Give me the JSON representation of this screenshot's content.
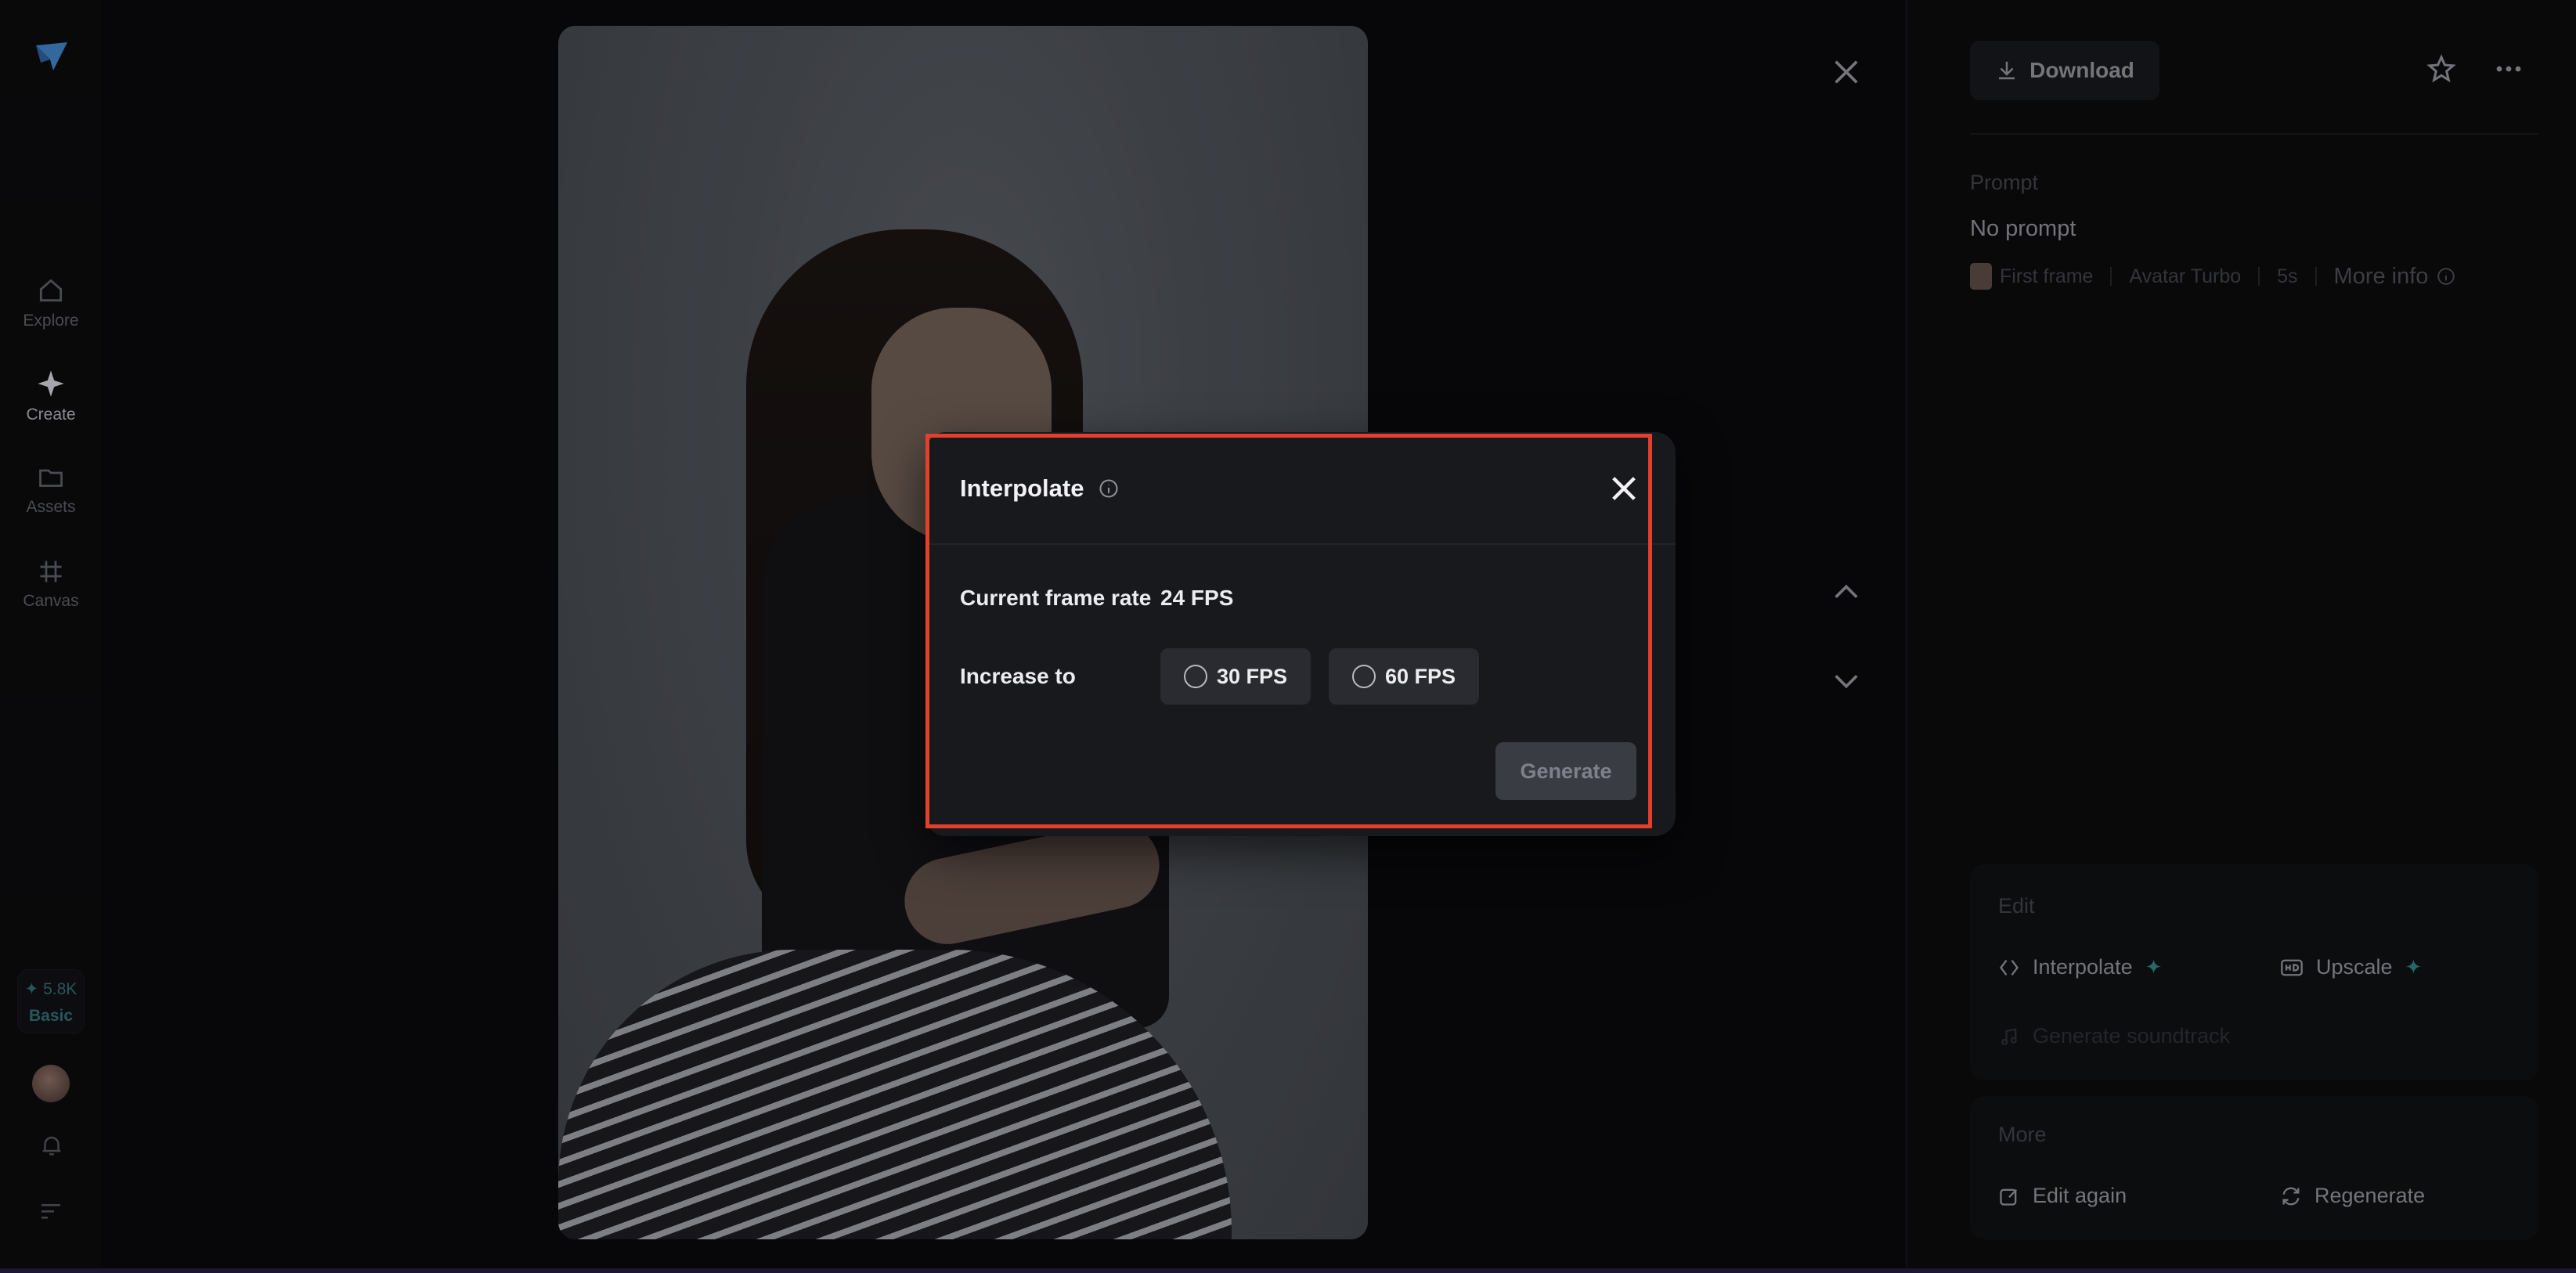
{
  "nav": {
    "items": [
      {
        "label": "Explore",
        "icon": "home-icon"
      },
      {
        "label": "Create",
        "icon": "sparkle-icon"
      },
      {
        "label": "Assets",
        "icon": "folder-icon"
      },
      {
        "label": "Canvas",
        "icon": "grid-icon"
      }
    ],
    "credits": {
      "amount": "✦ 5.8K",
      "plan": "Basic"
    }
  },
  "panel": {
    "download_label": "Download",
    "prompt_heading": "Prompt",
    "prompt_value": "No prompt",
    "meta": {
      "first_frame": "First frame",
      "model": "Avatar Turbo",
      "duration": "5s",
      "more_info": "More info"
    },
    "edit": {
      "heading": "Edit",
      "interpolate": "Interpolate",
      "upscale": "Upscale",
      "soundtrack": "Generate soundtrack"
    },
    "more": {
      "heading": "More",
      "edit_again": "Edit again",
      "regenerate": "Regenerate"
    }
  },
  "dialog": {
    "title": "Interpolate",
    "current_label": "Current frame rate",
    "current_value": "24 FPS",
    "increase_label": "Increase to",
    "options": [
      "30 FPS",
      "60 FPS"
    ],
    "generate_label": "Generate"
  },
  "colors": {
    "highlight": "#e2402d",
    "accent": "#2f7e80"
  }
}
